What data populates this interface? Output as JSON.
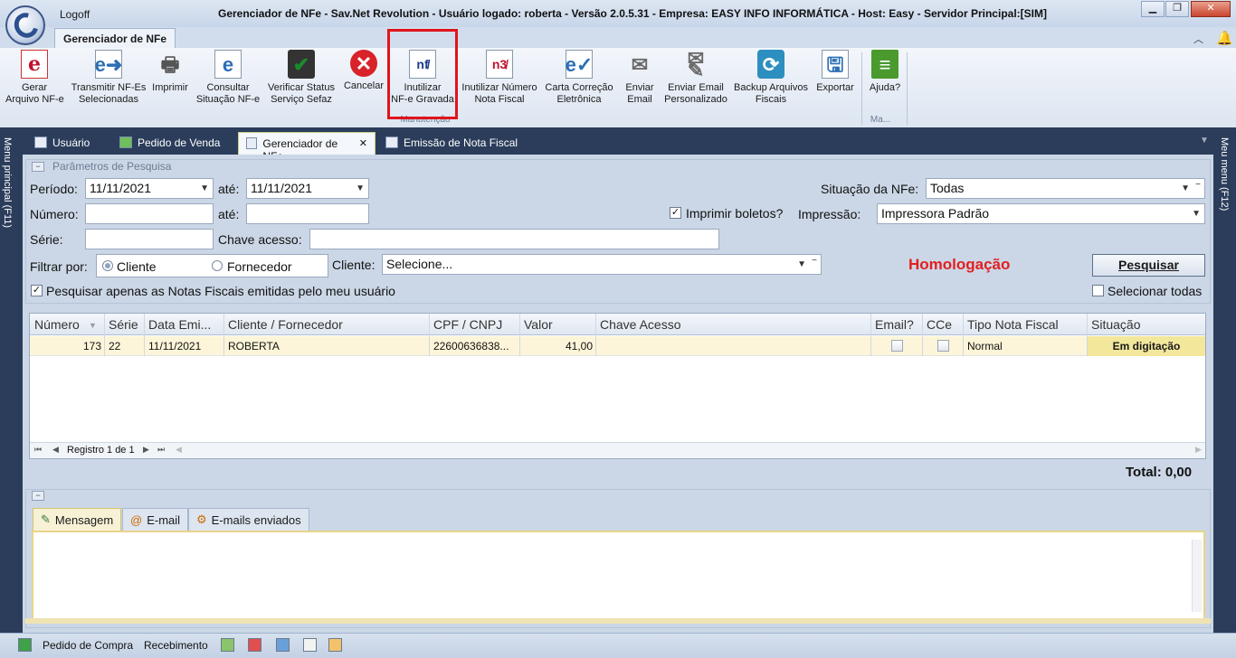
{
  "titlebar": {
    "logoff": "Logoff",
    "title": "Gerenciador de NFe - Sav.Net Revolution - Usuário logado: roberta - Versão 2.0.5.31 - Empresa: EASY INFO INFORMÁTICA - Host: Easy - Servidor Principal:[SIM]",
    "min": "▁",
    "max": "❐",
    "close": "✕"
  },
  "ribbon": {
    "tab": "Gerenciador de NFe",
    "buttons": [
      {
        "label": "Gerar\nArquivo NF-e",
        "icon": "nfe-e-icon"
      },
      {
        "label": "Transmitir NF-Es\nSelecionadas",
        "icon": "transmit-icon"
      },
      {
        "label": "Imprimir",
        "icon": "printer-icon"
      },
      {
        "label": "Consultar\nSituação NF-e",
        "icon": "consult-icon"
      },
      {
        "label": "Verificar Status\nServiço Sefaz",
        "icon": "server-check-icon"
      },
      {
        "label": "Cancelar",
        "icon": "cancel-icon"
      },
      {
        "label": "Inutilizar\nNF-e Gravada",
        "icon": "nf-void-icon"
      },
      {
        "label": "Inutilizar Número\nNota Fiscal",
        "icon": "number-void-icon"
      },
      {
        "label": "Carta Correção\nEletrônica",
        "icon": "correction-letter-icon"
      },
      {
        "label": "Enviar\nEmail",
        "icon": "email-icon"
      },
      {
        "label": "Enviar Email\nPersonalizado",
        "icon": "email-custom-icon"
      },
      {
        "label": "Backup Arquivos\nFiscais",
        "icon": "backup-icon"
      },
      {
        "label": "Exportar",
        "icon": "export-icon"
      },
      {
        "label": "Ajuda?",
        "icon": "help-book-icon"
      }
    ],
    "group1": "Manutenção",
    "group2": "Ma..."
  },
  "sidebars": {
    "left": "Menu principal (F11)",
    "right": "Meu menu (F12)"
  },
  "doctabs": [
    "Usuário",
    "Pedido de Venda",
    "Gerenciador de NFe",
    "Emissão de Nota Fiscal"
  ],
  "params": {
    "header": "Parâmetros de Pesquisa",
    "periodo_label": "Período:",
    "periodo_de": "11/11/2021",
    "ate_label": "até:",
    "periodo_ate": "11/11/2021",
    "numero_label": "Número:",
    "numero_de": "",
    "numero_ate": "",
    "serie_label": "Série:",
    "serie": "",
    "chave_label": "Chave acesso:",
    "chave": "",
    "filtrar_label": "Filtrar por:",
    "opt_cliente": "Cliente",
    "opt_fornecedor": "Fornecedor",
    "cliente_label": "Cliente:",
    "cliente_value": "Selecione...",
    "situacao_label": "Situação da NFe:",
    "situacao_value": "Todas",
    "imprimir_boletos": "Imprimir boletos?",
    "impressao_label": "Impressão:",
    "impressao_value": "Impressora Padrão",
    "homologacao": "Homologação",
    "pesquisar": "Pesquisar",
    "apenas_meu_usuario": "Pesquisar apenas as Notas Fiscais emitidas pelo meu usuário",
    "selecionar_todas": "Selecionar todas"
  },
  "grid": {
    "headers": [
      "Número",
      "Série",
      "Data Emi...",
      "Cliente / Fornecedor",
      "CPF / CNPJ",
      "Valor",
      "Chave Acesso",
      "Email?",
      "CCe",
      "Tipo Nota Fiscal",
      "Situação"
    ],
    "rows": [
      {
        "numero": "173",
        "serie": "22",
        "data": "11/11/2021",
        "cliente": "ROBERTA",
        "cpf": "22600636838...",
        "valor": "41,00",
        "chave": "",
        "tipo": "Normal",
        "situacao": "Em digitação"
      }
    ],
    "registro": "Registro 1 de 1",
    "total": "Total: 0,00"
  },
  "msgtabs": [
    "Mensagem",
    "E-mail",
    "E-mails enviados"
  ],
  "statusbar": {
    "pedido_compra": "Pedido de Compra",
    "recebimento": "Recebimento"
  }
}
